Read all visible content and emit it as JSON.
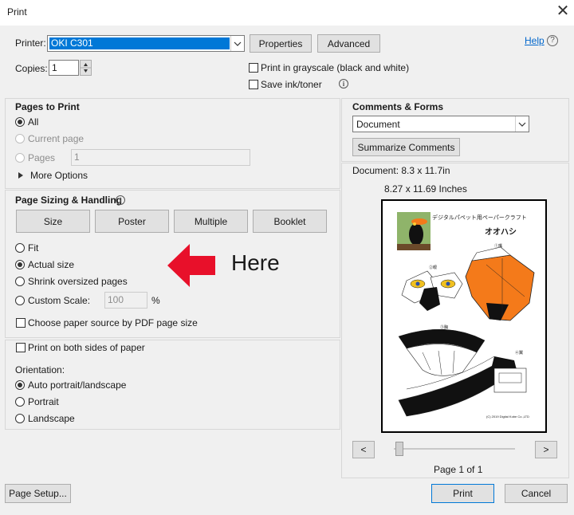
{
  "window": {
    "title": "Print",
    "close_glyph": "✕"
  },
  "printer": {
    "label": "Printer:",
    "value": "OKI C301",
    "properties_label": "Properties",
    "advanced_label": "Advanced",
    "help_label": "Help"
  },
  "copies": {
    "label": "Copies:",
    "value": "1"
  },
  "options": {
    "grayscale_label": "Print in grayscale (black and white)",
    "save_ink_label": "Save ink/toner"
  },
  "pages_to_print": {
    "header": "Pages to Print",
    "all_label": "All",
    "current_label": "Current page",
    "pages_label": "Pages",
    "pages_value": "1",
    "more_options_label": "More Options"
  },
  "page_sizing": {
    "header": "Page Sizing & Handling",
    "size_label": "Size",
    "poster_label": "Poster",
    "multiple_label": "Multiple",
    "booklet_label": "Booklet",
    "fit_label": "Fit",
    "actual_label": "Actual size",
    "shrink_label": "Shrink oversized pages",
    "custom_label": "Custom Scale:",
    "custom_value": "100",
    "percent": "%",
    "paper_source_label": "Choose paper source by PDF page size"
  },
  "annotation": {
    "text": "Here",
    "arrow_color": "#e8102a"
  },
  "duplex": {
    "label": "Print on both sides of paper"
  },
  "orientation": {
    "label": "Orientation:",
    "auto_label": "Auto portrait/landscape",
    "portrait_label": "Portrait",
    "landscape_label": "Landscape"
  },
  "comments": {
    "header": "Comments & Forms",
    "value": "Document",
    "summarize_label": "Summarize Comments"
  },
  "preview": {
    "doc_size": "Document: 8.3 x 11.7in",
    "paper_size": "8.27 x 11.69 Inches",
    "page_title_jp": "デジタルパペット用ペーパークラフト",
    "page_subtitle_jp": "オオハシ",
    "page_footer": "(C) 2019 Digital Kobe Co.,LTD",
    "part_labels": [
      "①嘴",
      "②眼",
      "③胸",
      "④翼"
    ],
    "prev_label": "<",
    "next_label": ">",
    "page_indicator": "Page 1 of 1"
  },
  "footer": {
    "page_setup_label": "Page Setup...",
    "print_label": "Print",
    "cancel_label": "Cancel"
  },
  "colors": {
    "selection": "#0078d7",
    "toucan_orange": "#f47a1a",
    "link": "#0066cc"
  }
}
